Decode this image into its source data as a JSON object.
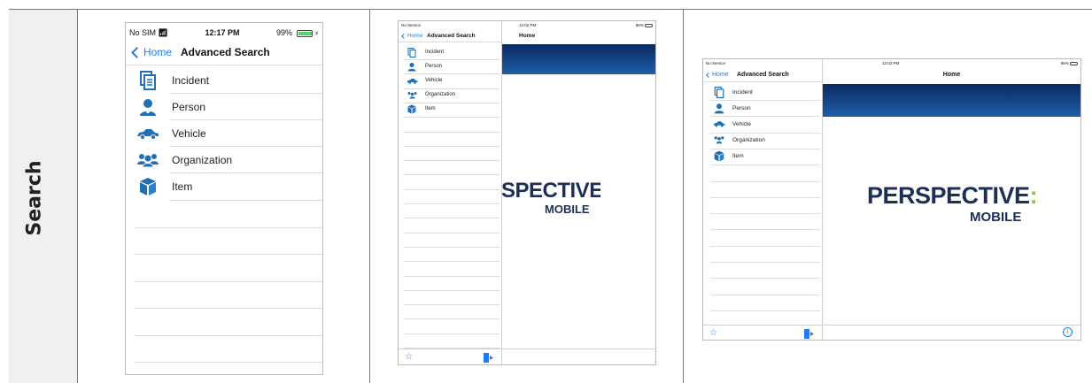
{
  "row_label": "Search",
  "phone": {
    "status": {
      "carrier": "No SIM",
      "time": "12:17 PM",
      "battery": "99%",
      "battery_level": 0.99
    },
    "nav": {
      "back": "Home",
      "title": "Advanced Search"
    },
    "items": [
      {
        "label": "Incident",
        "icon": "document-icon"
      },
      {
        "label": "Person",
        "icon": "person-icon"
      },
      {
        "label": "Vehicle",
        "icon": "car-icon"
      },
      {
        "label": "Organization",
        "icon": "group-icon"
      },
      {
        "label": "Item",
        "icon": "box-icon"
      }
    ]
  },
  "ipad_portrait": {
    "status": {
      "carrier": "No Service",
      "time": "12:02 PM",
      "battery": "86%",
      "battery_level": 0.86
    },
    "nav": {
      "back": "Home",
      "title": "Advanced Search",
      "detail_title": "Home"
    },
    "items": [
      {
        "label": "Incident",
        "icon": "document-icon"
      },
      {
        "label": "Person",
        "icon": "person-icon"
      },
      {
        "label": "Vehicle",
        "icon": "car-icon"
      },
      {
        "label": "Organization",
        "icon": "group-icon"
      },
      {
        "label": "Item",
        "icon": "box-icon"
      }
    ],
    "logo": {
      "main": "SPECTIVE",
      "colon": ":",
      "sub": "MOBILE"
    },
    "toolbar": {
      "left_icon": "star-icon",
      "right_icon": "logout-icon"
    }
  },
  "ipad_landscape": {
    "status": {
      "carrier": "No Service",
      "time": "12:02 PM",
      "battery": "86%",
      "battery_level": 0.86
    },
    "nav": {
      "back": "Home",
      "title": "Advanced Search",
      "detail_title": "Home"
    },
    "items": [
      {
        "label": "Incident",
        "icon": "document-icon"
      },
      {
        "label": "Person",
        "icon": "person-icon"
      },
      {
        "label": "Vehicle",
        "icon": "car-icon"
      },
      {
        "label": "Organization",
        "icon": "group-icon"
      },
      {
        "label": "Item",
        "icon": "box-icon"
      }
    ],
    "logo": {
      "main": "PERSPECTIVE",
      "colon": ":",
      "sub": "MOBILE"
    },
    "toolbar": {
      "left_icon": "star-icon",
      "mid_icon": "logout-icon",
      "right_icon": "info-icon"
    }
  },
  "colors": {
    "accent": "#1a7ef2",
    "icon_blue": "#1f6fb5",
    "banner_dark": "#0b2a61",
    "banner_light": "#1f5ea8",
    "logo_navy": "#1e2f56",
    "logo_green": "#8cc63f"
  }
}
